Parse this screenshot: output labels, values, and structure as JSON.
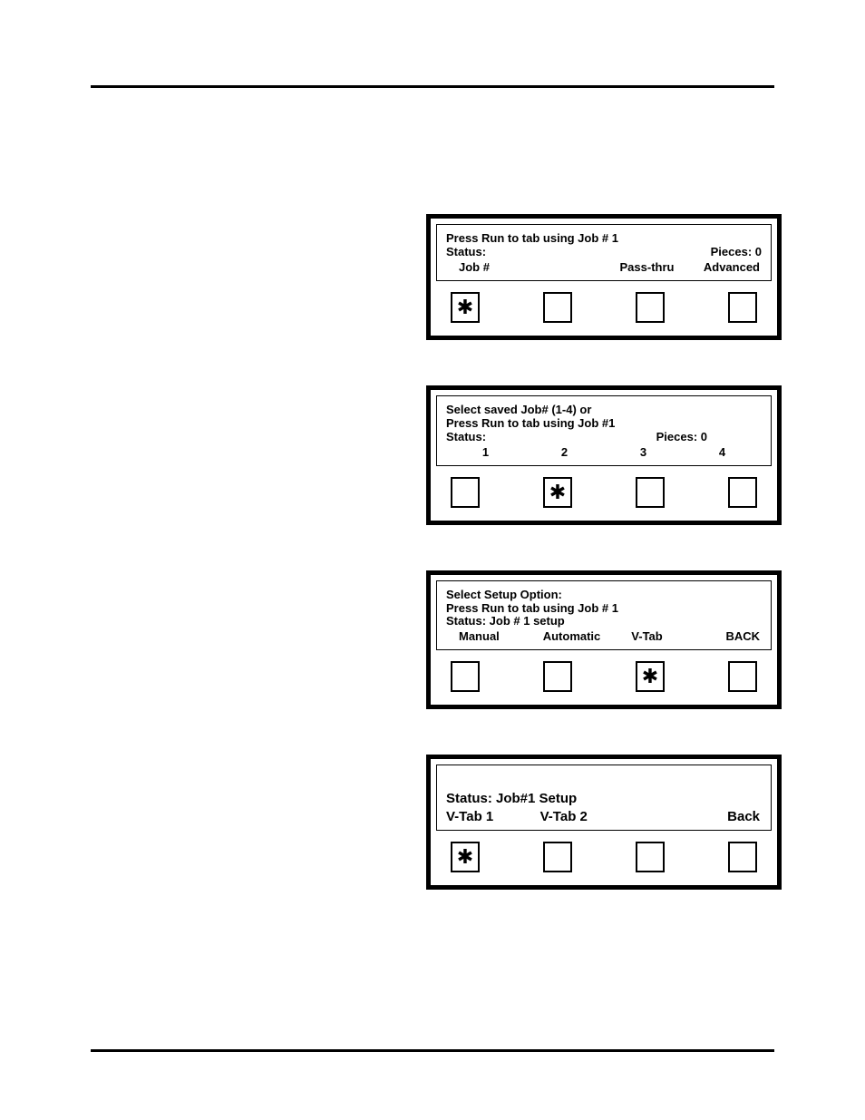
{
  "panel1": {
    "line_prompt": "Press Run to tab using Job # 1",
    "status_label": "Status:",
    "pieces_label": "Pieces: 0",
    "actions": [
      "Job #",
      "",
      "Pass-thru",
      "Advanced"
    ],
    "selected_index": 0
  },
  "panel2": {
    "line1": "Select saved Job# (1-4) or",
    "line2": "Press Run to tab using Job #1",
    "status_label": "Status:",
    "pieces_label": "Pieces: 0",
    "actions": [
      "1",
      "2",
      "3",
      "4"
    ],
    "selected_index": 1
  },
  "panel3": {
    "line1": "Select Setup Option:",
    "line2": "Press Run to tab using Job # 1",
    "line3": "Status: Job # 1 setup",
    "actions": [
      "Manual",
      "Automatic",
      "V-Tab",
      "BACK"
    ],
    "selected_index": 2
  },
  "panel4": {
    "status_line": "Status: Job#1 Setup",
    "actions": [
      "V-Tab 1",
      "V-Tab 2",
      "",
      "Back"
    ],
    "selected_index": 0
  },
  "glyph_selected": "✱"
}
